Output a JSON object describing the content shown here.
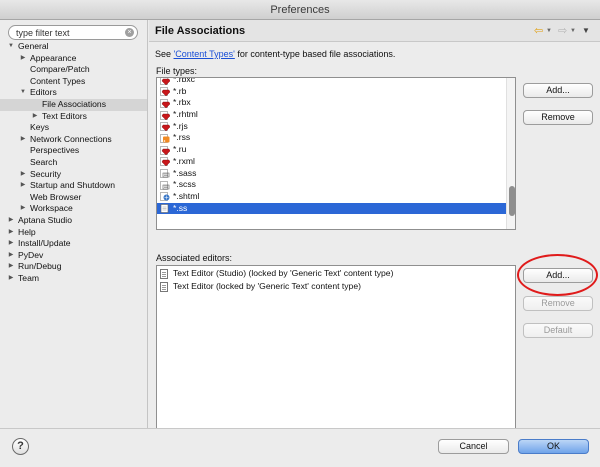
{
  "window": {
    "title": "Preferences"
  },
  "search": {
    "placeholder": "type filter text",
    "value": "type filter text"
  },
  "tree": [
    {
      "label": "General",
      "level": 0,
      "expanded": true
    },
    {
      "label": "Appearance",
      "level": 1,
      "expandable": true
    },
    {
      "label": "Compare/Patch",
      "level": 1
    },
    {
      "label": "Content Types",
      "level": 1
    },
    {
      "label": "Editors",
      "level": 1,
      "expanded": true
    },
    {
      "label": "File Associations",
      "level": 2,
      "selected": true
    },
    {
      "label": "Text Editors",
      "level": 2,
      "expandable": true
    },
    {
      "label": "Keys",
      "level": 1
    },
    {
      "label": "Network Connections",
      "level": 1,
      "expandable": true
    },
    {
      "label": "Perspectives",
      "level": 1
    },
    {
      "label": "Search",
      "level": 1
    },
    {
      "label": "Security",
      "level": 1,
      "expandable": true
    },
    {
      "label": "Startup and Shutdown",
      "level": 1,
      "expandable": true
    },
    {
      "label": "Web Browser",
      "level": 1
    },
    {
      "label": "Workspace",
      "level": 1,
      "expandable": true
    },
    {
      "label": "Aptana Studio",
      "level": 0,
      "expandable": true
    },
    {
      "label": "Help",
      "level": 0,
      "expandable": true
    },
    {
      "label": "Install/Update",
      "level": 0,
      "expandable": true
    },
    {
      "label": "PyDev",
      "level": 0,
      "expandable": true
    },
    {
      "label": "Run/Debug",
      "level": 0,
      "expandable": true
    },
    {
      "label": "Team",
      "level": 0,
      "expandable": true
    }
  ],
  "page": {
    "title": "File Associations",
    "see_prefix": "See ",
    "see_link": "'Content Types'",
    "see_suffix": " for content-type based file associations.",
    "file_types_label": "File types:",
    "file_types": [
      {
        "name": "*.rbxc",
        "icon": "ruby-gem-icon"
      },
      {
        "name": "*.rb",
        "icon": "ruby-gem-icon"
      },
      {
        "name": "*.rbx",
        "icon": "ruby-gem-icon"
      },
      {
        "name": "*.rhtml",
        "icon": "ruby-gem-icon"
      },
      {
        "name": "*.rjs",
        "icon": "ruby-gem-icon"
      },
      {
        "name": "*.rss",
        "icon": "rss-icon"
      },
      {
        "name": "*.ru",
        "icon": "ruby-gem-icon"
      },
      {
        "name": "*.rxml",
        "icon": "ruby-gem-icon"
      },
      {
        "name": "*.sass",
        "icon": "sass-icon"
      },
      {
        "name": "*.scss",
        "icon": "sass-icon"
      },
      {
        "name": "*.shtml",
        "icon": "html-icon"
      },
      {
        "name": "*.ss",
        "icon": "document-icon",
        "selected": true
      }
    ],
    "associated_label": "Associated editors:",
    "editors": [
      {
        "name": "Text Editor (Studio) (locked by 'Generic Text' content type)"
      },
      {
        "name": "Text Editor (locked by 'Generic Text' content type)"
      }
    ],
    "buttons": {
      "types_add": "Add...",
      "types_remove": "Remove",
      "editors_add": "Add...",
      "editors_remove": "Remove",
      "editors_default": "Default"
    }
  },
  "footer": {
    "help": "?",
    "cancel": "Cancel",
    "ok": "OK"
  },
  "colors": {
    "selection": "#2b67d6",
    "highlight_ring": "#e01b1b",
    "link": "#1a4fd6"
  }
}
